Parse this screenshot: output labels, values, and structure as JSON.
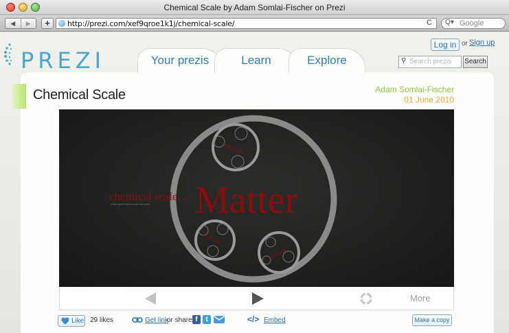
{
  "window": {
    "title": "Chemical Scale by Adam Somlai-Fischer on Prezi",
    "url": "http://prezi.com/xef9qroe1k1j/chemical-scale/",
    "back_glyph": "◀",
    "forward_glyph": "▶",
    "add_glyph": "+",
    "reload_glyph": "C",
    "search_placeholder": "Google",
    "search_glyph": "Q▾"
  },
  "header": {
    "logo_text": "PREZI",
    "tabs": [
      {
        "label": "Your prezis"
      },
      {
        "label": "Learn"
      },
      {
        "label": "Explore"
      }
    ],
    "login_label": "Log in",
    "or_label": "or",
    "signup_label": "Sign up",
    "search_placeholder": "Search prezis",
    "search_button": "Search"
  },
  "prezi": {
    "title": "Chemical Scale",
    "author": "Adam Somlai-Fischer",
    "date": "01 June 2010",
    "slide_big_word": "Matter",
    "slide_subtitle": "chemical scale...",
    "slide_caption": "a tiny experiment on scale and zoom",
    "slide_small_word": "molecule",
    "more_label": "More"
  },
  "actions": {
    "like_label": "Like",
    "likes_count": "29 likes",
    "get_link": "Get link",
    "or_share": "or share",
    "embed_glyph": "</>",
    "embed_label": "Embed",
    "copy_label": "Make a copy"
  },
  "colors": {
    "accent_blue": "#2a72a6",
    "author_green": "#8dc63f",
    "date_orange": "#e8a739",
    "slide_red": "#8b0d0d"
  }
}
